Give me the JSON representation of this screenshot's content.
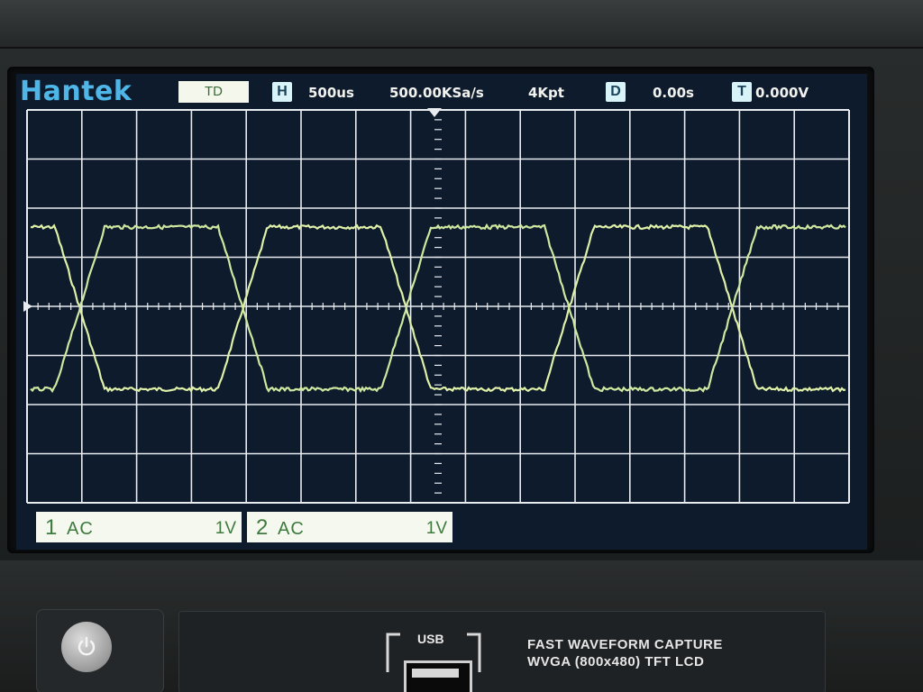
{
  "brand": "Hantek",
  "header": {
    "mode": "TD",
    "horizontal_marker": "H",
    "timebase": "500us",
    "sample_rate": "500.00KSa/s",
    "memory_depth": "4Kpt",
    "delay_marker": "D",
    "delay": "0.00s",
    "trigger_marker": "T",
    "trigger_level": "0.000V"
  },
  "channels": [
    {
      "number": "1",
      "coupling": "AC",
      "scale": "1V"
    },
    {
      "number": "2",
      "coupling": "AC",
      "scale": "1V"
    }
  ],
  "front_panel": {
    "usb_label": "USB",
    "feature_line1": "FAST WAVEFORM CAPTURE",
    "feature_line2": "WVGA (800x480) TFT LCD"
  },
  "trace_color": "#dff0a8",
  "logo_color": "#4fb6e8"
}
